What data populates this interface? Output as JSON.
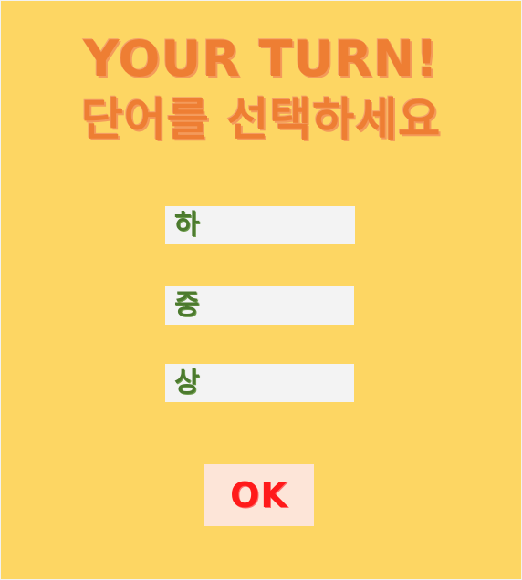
{
  "header": {
    "title_line1": "YOUR TURN!",
    "title_line2": "단어를 선택하세요"
  },
  "choices": [
    {
      "label": "하"
    },
    {
      "label": "중"
    },
    {
      "label": "상"
    }
  ],
  "ok_button": {
    "label": "OK"
  },
  "colors": {
    "background": "#FDD663",
    "title": "#EE7E33",
    "choice_background": "#F3F3F3",
    "choice_text": "#4C7A2E",
    "ok_background": "#FDE5D8",
    "ok_text": "#FF1A1A"
  }
}
